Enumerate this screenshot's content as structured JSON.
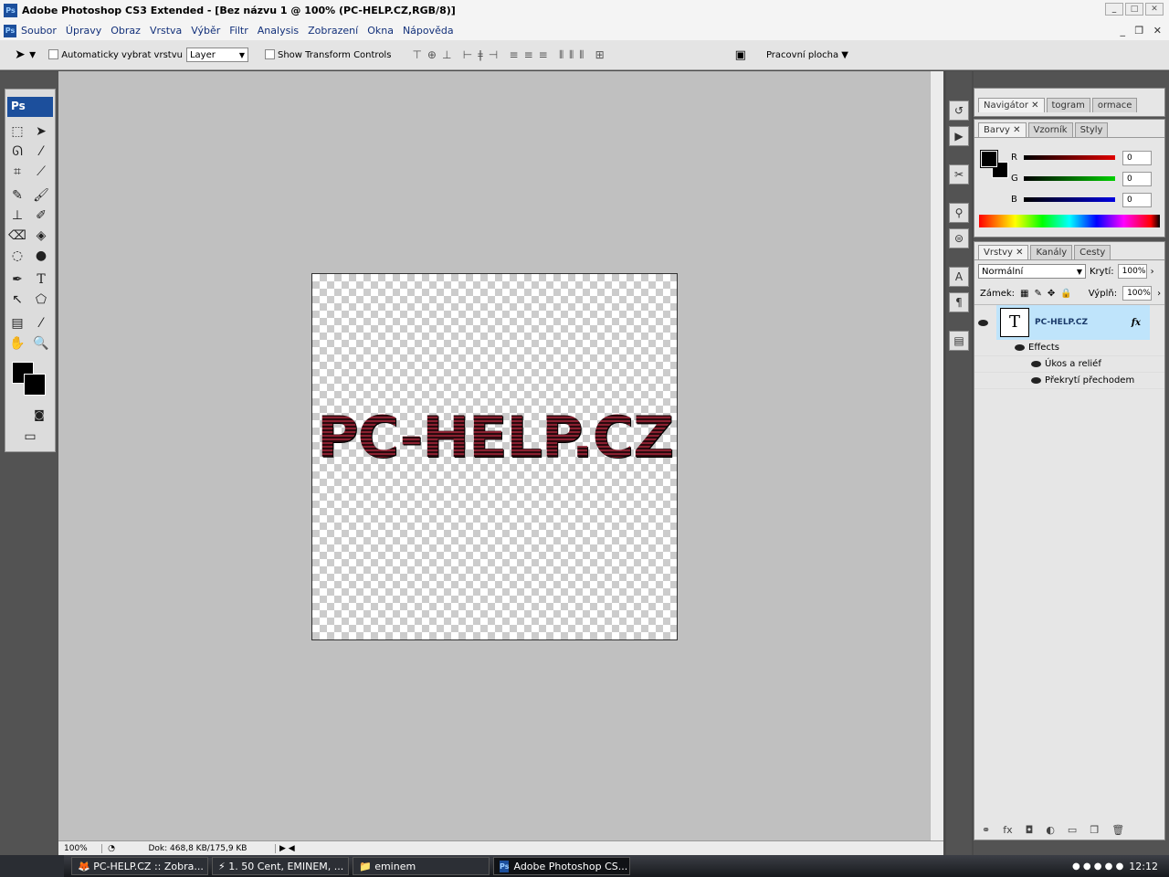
{
  "window": {
    "title": "Adobe Photoshop CS3 Extended - [Bez názvu 1 @ 100% (PC-HELP.CZ,RGB/8)]",
    "app_icon": "Ps"
  },
  "menu": [
    "Soubor",
    "Úpravy",
    "Obraz",
    "Vrstva",
    "Výběr",
    "Filtr",
    "Analysis",
    "Zobrazení",
    "Okna",
    "Nápověda"
  ],
  "options": {
    "auto_select_label": "Automaticky vybrat vrstvu",
    "auto_select_value": "Layer",
    "transform_label": "Show Transform Controls",
    "workspace_label": "Pracovní plocha"
  },
  "toolbox": {
    "logo": "Ps"
  },
  "canvas": {
    "text": "PC-HELP.CZ"
  },
  "status": {
    "zoom": "100%",
    "doc": "Dok: 468,8 KB/175,9 KB"
  },
  "navigator_panel": {
    "tabs": [
      "Navigátor",
      "togram",
      "ormace"
    ]
  },
  "color_panel": {
    "tabs": [
      "Barvy",
      "Vzorník",
      "Styly"
    ],
    "channels": [
      {
        "label": "R",
        "value": "0",
        "color": "#e00000"
      },
      {
        "label": "G",
        "value": "0",
        "color": "#00d000"
      },
      {
        "label": "B",
        "value": "0",
        "color": "#0000e0"
      }
    ]
  },
  "layers_panel": {
    "tabs": [
      "Vrstvy",
      "Kanály",
      "Cesty"
    ],
    "blend_mode": "Normální",
    "opacity_label": "Krytí:",
    "opacity": "100%",
    "lock_label": "Zámek:",
    "fill_label": "Výplň:",
    "fill": "100%",
    "layer": {
      "name": "PC-HELP.CZ",
      "thumb": "T",
      "fx": "fx"
    },
    "effects_label": "Effects",
    "effects": [
      "Úkos a reliéf",
      "Překrytí přechodem"
    ]
  },
  "taskbar": {
    "tasks": [
      "PC-HELP.CZ :: Zobra...",
      "1. 50 Cent, EMINEM, ...",
      "eminem",
      "Adobe Photoshop CS..."
    ],
    "clock": "12:12"
  }
}
